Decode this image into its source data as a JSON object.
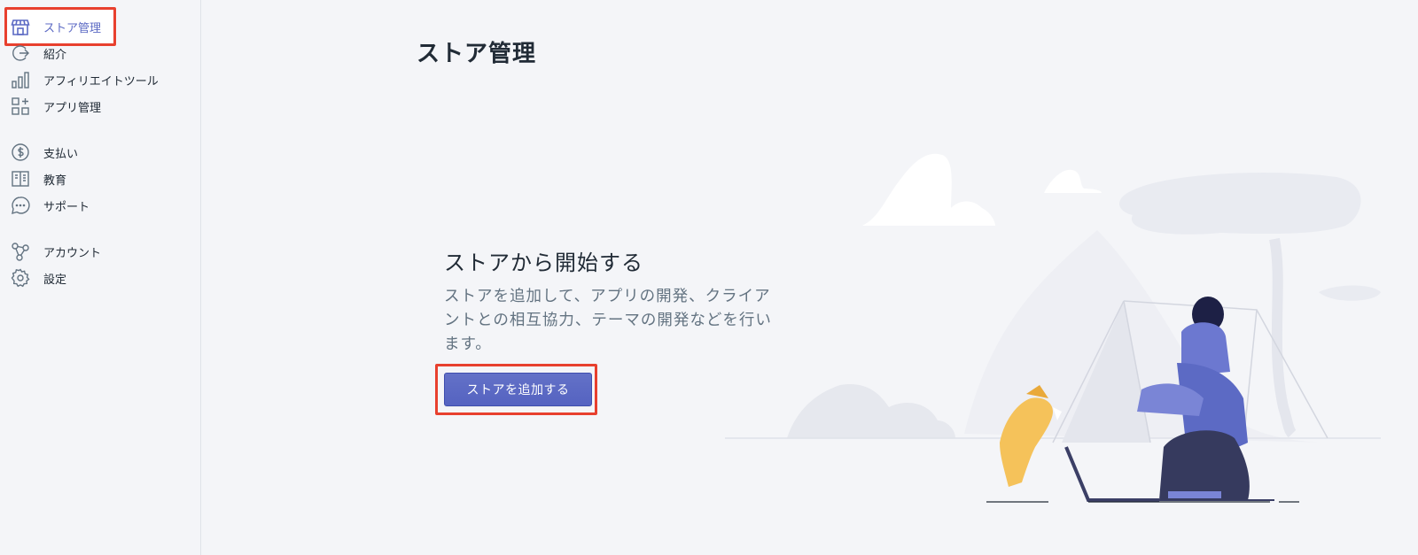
{
  "sidebar": {
    "items": [
      {
        "label": "ストア管理",
        "icon": "store-icon",
        "active": true
      },
      {
        "label": "紹介",
        "icon": "referral-icon"
      },
      {
        "label": "アフィリエイトツール",
        "icon": "bar-chart-icon"
      },
      {
        "label": "アプリ管理",
        "icon": "apps-icon"
      },
      {
        "label": "支払い",
        "icon": "dollar-circle-icon"
      },
      {
        "label": "教育",
        "icon": "book-icon"
      },
      {
        "label": "サポート",
        "icon": "chat-bubble-icon"
      },
      {
        "label": "アカウント",
        "icon": "account-icon"
      },
      {
        "label": "設定",
        "icon": "gear-icon"
      }
    ]
  },
  "main": {
    "page_title": "ストア管理",
    "empty_state": {
      "heading": "ストアから開始する",
      "description": "ストアを追加して、アプリの開発、クライアントとの相互協力、テーマの開発などを行います。",
      "button_label": "ストアを追加する"
    }
  },
  "colors": {
    "accent": "#5c6ac4",
    "highlight": "#e8402e",
    "background": "#f4f5f8"
  }
}
